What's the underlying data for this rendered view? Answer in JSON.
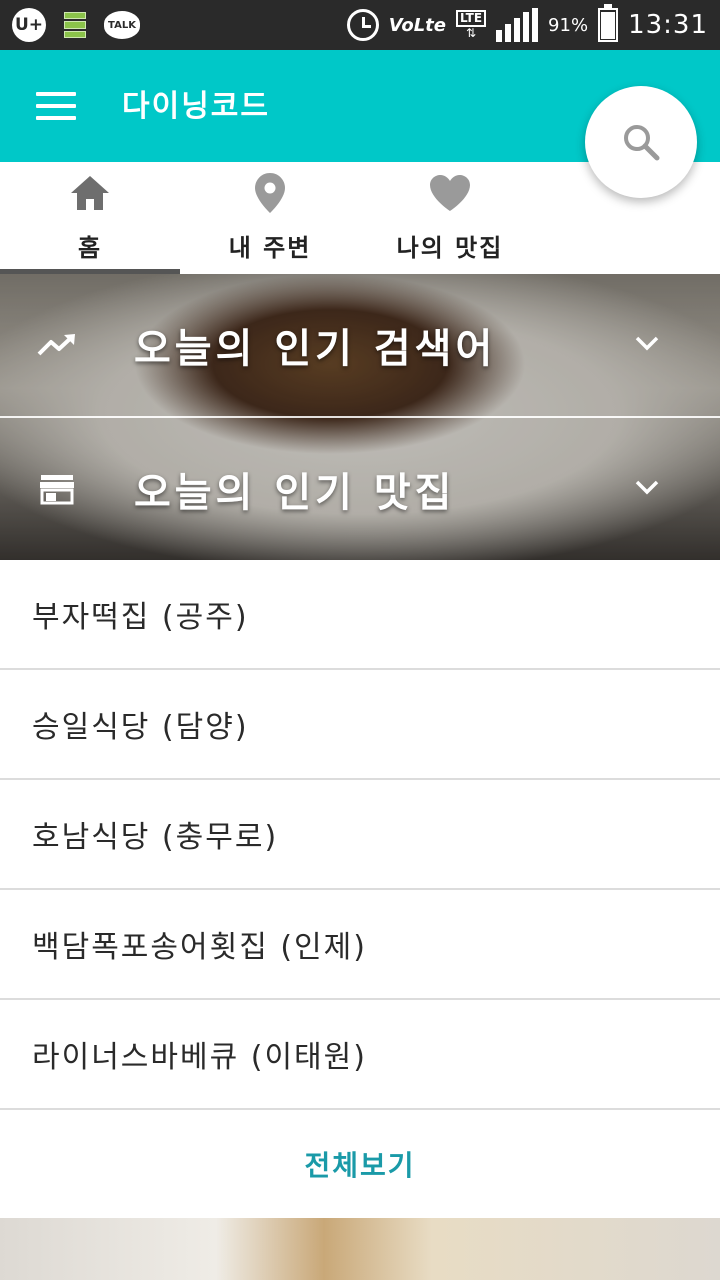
{
  "status_bar": {
    "carrier_icon": "U+",
    "talk_label": "TALK",
    "network_label": "Vo",
    "network_label_suffix": "Lte",
    "lte_label": "LTE",
    "battery": "91%",
    "battery_level": 0.91,
    "time": "13:31"
  },
  "app_bar": {
    "title": "다이닝코드",
    "menu_icon": "hamburger-icon",
    "search_icon": "search-icon"
  },
  "tabs": [
    {
      "label": "홈",
      "icon": "home-icon",
      "active": true
    },
    {
      "label": "내 주변",
      "icon": "location-pin-icon",
      "active": false
    },
    {
      "label": "나의 맛집",
      "icon": "heart-icon",
      "active": false
    }
  ],
  "sections": {
    "trending": {
      "label": "오늘의 인기 검색어",
      "icon": "trending-up-icon"
    },
    "popular": {
      "label": "오늘의 인기 맛집",
      "icon": "store-icon"
    }
  },
  "restaurants": [
    "부자떡집 (공주)",
    "승일식당 (담양)",
    "호남식당 (충무로)",
    "백담폭포송어횟집 (인제)",
    "라이너스바베큐 (이태원)"
  ],
  "view_all_label": "전체보기",
  "colors": {
    "accent": "#00c8c8",
    "link": "#1a9aa8",
    "tab_icon": "#6e6e6e"
  }
}
